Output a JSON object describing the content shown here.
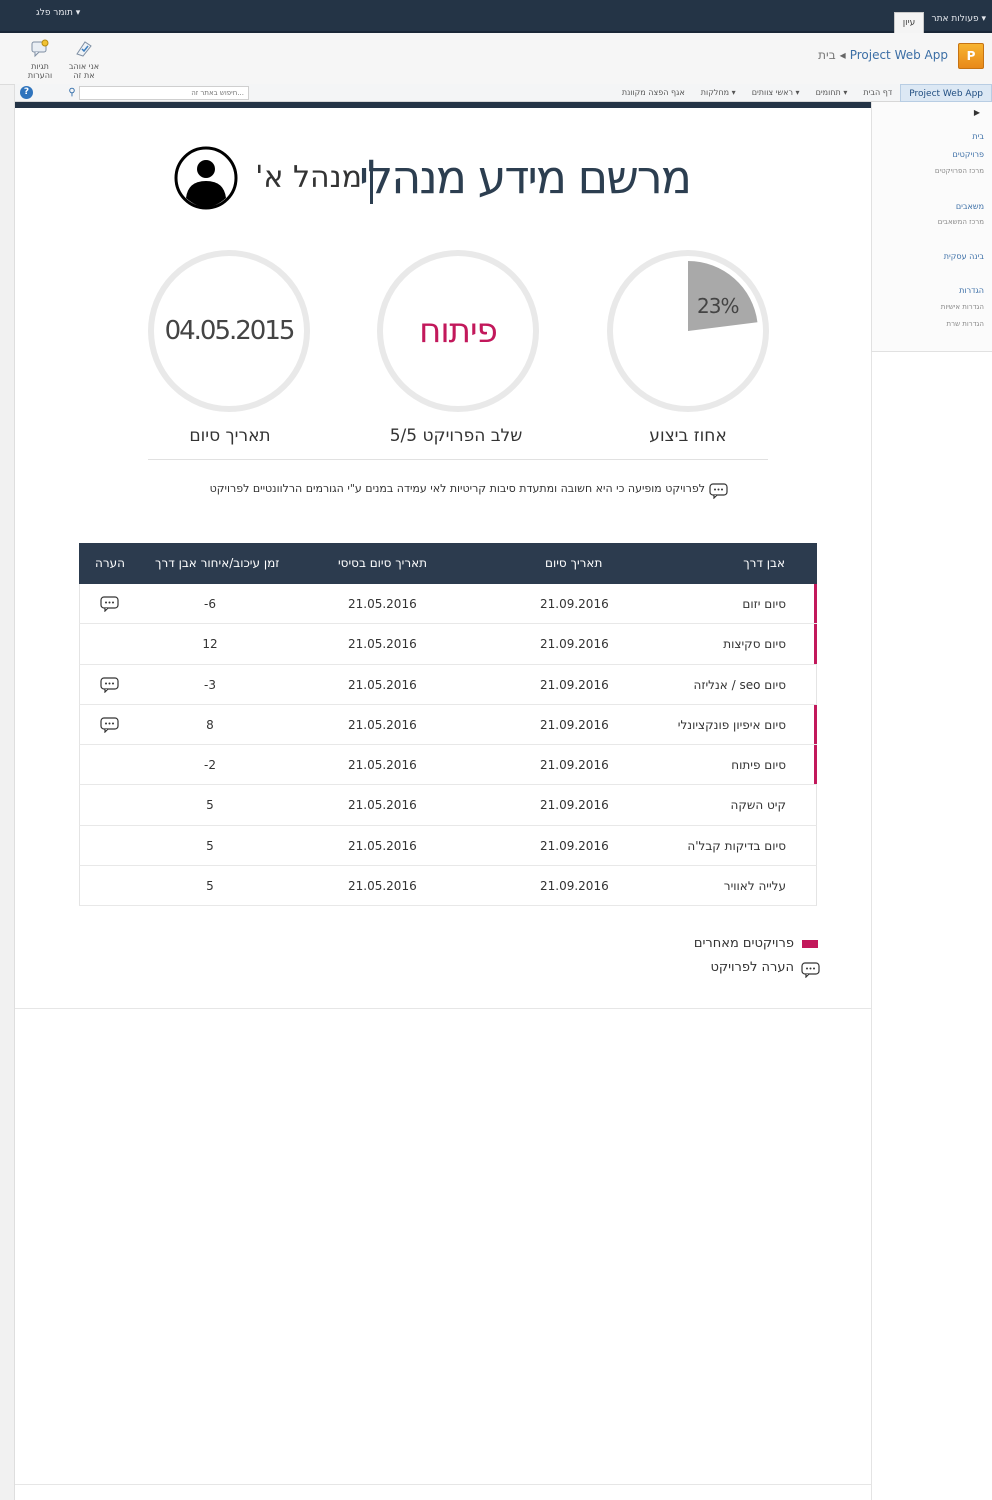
{
  "topbar": {
    "user_menu": "תומר פלג ▾",
    "site_actions": "פעולות אתר ▾",
    "edit_tab": "עיון"
  },
  "ribbon": {
    "buttons": [
      {
        "label": "אני אוהב את זה"
      },
      {
        "label": "תגיות והערות"
      }
    ],
    "breadcrumb": {
      "app": "Project Web App",
      "home": "בית"
    }
  },
  "nav": {
    "items": [
      {
        "label": "Project Web App",
        "active": true
      },
      {
        "label": "דף הבית"
      },
      {
        "label": "תחומים ▾"
      },
      {
        "label": "ראשי צוותים ▾"
      },
      {
        "label": "מחלקות ▾"
      },
      {
        "label": "אגף הפצה מקוונת"
      }
    ],
    "search_placeholder": "חיפוש באתר זה..."
  },
  "quicklaunch": {
    "items": [
      {
        "label": "בית",
        "sub": false
      },
      {
        "label": "פרויקטים",
        "sub": false
      },
      {
        "label": "מרכז הפרויקטים",
        "sub": true
      },
      {
        "label": "משאבים",
        "sub": false
      },
      {
        "label": "מרכז המשאבים",
        "sub": true
      },
      {
        "label": "בינה עסקית",
        "sub": false
      },
      {
        "label": "הגדרות",
        "sub": false
      },
      {
        "label": "הגדרות אישיות",
        "sub": true
      },
      {
        "label": "הגדרות שרת",
        "sub": true
      }
    ]
  },
  "header": {
    "title": "מרשם מידע מנהלי",
    "manager": "מנהל א'"
  },
  "kpis": {
    "end_date": {
      "value": "04.05.2015",
      "caption": "תאריך סיום"
    },
    "stage": {
      "value": "פיתוח",
      "caption": "שלב הפרויקט 5/5"
    },
    "completion": {
      "value": "23%",
      "percent": 23,
      "caption": "אחוז ביצוע"
    }
  },
  "note": "לפרויקט מופיעה כי היא חשובה ומתעדת סיבות קריטיות לאי עמידה במנים ע\"י הגורמים הרלוונטיים לפרויקט",
  "table": {
    "headers": {
      "milestone": "אבן דרך",
      "end_date": "תאריך סיום",
      "baseline_end": "תאריך סיום בסיסי",
      "delay": "זמן עיכוב/איחור אבן דרך",
      "comment": "הערה"
    },
    "rows": [
      {
        "milestone": "סיום יזום",
        "end_date": "21.09.2016",
        "baseline_end": "21.05.2016",
        "delay": "-6",
        "flag": true,
        "comment": true
      },
      {
        "milestone": "סיום סקיצות",
        "end_date": "21.09.2016",
        "baseline_end": "21.05.2016",
        "delay": "12",
        "flag": true,
        "comment": false
      },
      {
        "milestone": "סיום seo / אנליזה",
        "end_date": "21.09.2016",
        "baseline_end": "21.05.2016",
        "delay": "-3",
        "flag": false,
        "comment": true
      },
      {
        "milestone": "סיום איפיון פונקציונלי",
        "end_date": "21.09.2016",
        "baseline_end": "21.05.2016",
        "delay": "8",
        "flag": true,
        "comment": true
      },
      {
        "milestone": "סיום פיתוח",
        "end_date": "21.09.2016",
        "baseline_end": "21.05.2016",
        "delay": "-2",
        "flag": true,
        "comment": false
      },
      {
        "milestone": "קיט השקה",
        "end_date": "21.09.2016",
        "baseline_end": "21.05.2016",
        "delay": "5",
        "flag": false,
        "comment": false
      },
      {
        "milestone": "סיום בדיקות קבל'ה",
        "end_date": "21.09.2016",
        "baseline_end": "21.05.2016",
        "delay": "5",
        "flag": false,
        "comment": false
      },
      {
        "milestone": "עלייה לאוויר",
        "end_date": "21.09.2016",
        "baseline_end": "21.05.2016",
        "delay": "5",
        "flag": false,
        "comment": false
      }
    ]
  },
  "legend": {
    "other_projects": "פרויקטים מאחרים",
    "project_comment": "הערה לפרויקט"
  },
  "colors": {
    "accent": "#c2185b",
    "header_dark": "#2c3b4e",
    "topbar": "#243446"
  }
}
